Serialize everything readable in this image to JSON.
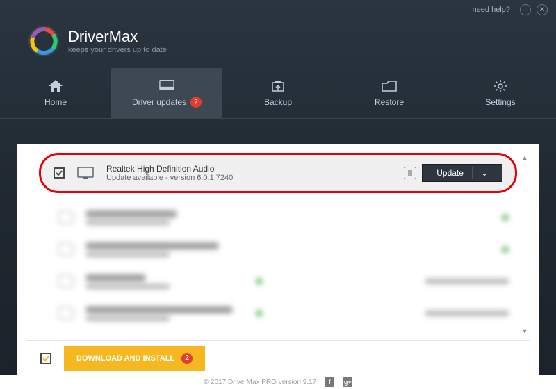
{
  "titlebar": {
    "help": "need help?"
  },
  "brand": {
    "title": "DriverMax",
    "subtitle": "keeps your drivers up to date"
  },
  "tabs": {
    "home": "Home",
    "updates": "Driver updates",
    "updates_badge": "2",
    "backup": "Backup",
    "restore": "Restore",
    "settings": "Settings"
  },
  "driver": {
    "name": "Realtek High Definition Audio",
    "status": "Update available - version 6.0.1.7240",
    "button": "Update"
  },
  "blurred_rows": [
    {
      "name_w": 130
    },
    {
      "name_w": 190
    },
    {
      "name_w": 85,
      "right": true
    },
    {
      "name_w": 210,
      "right": true
    }
  ],
  "download_button": "DOWNLOAD AND INSTALL",
  "download_badge": "2",
  "footer": {
    "copyright": "© 2017 DriverMax PRO version 9.17"
  }
}
